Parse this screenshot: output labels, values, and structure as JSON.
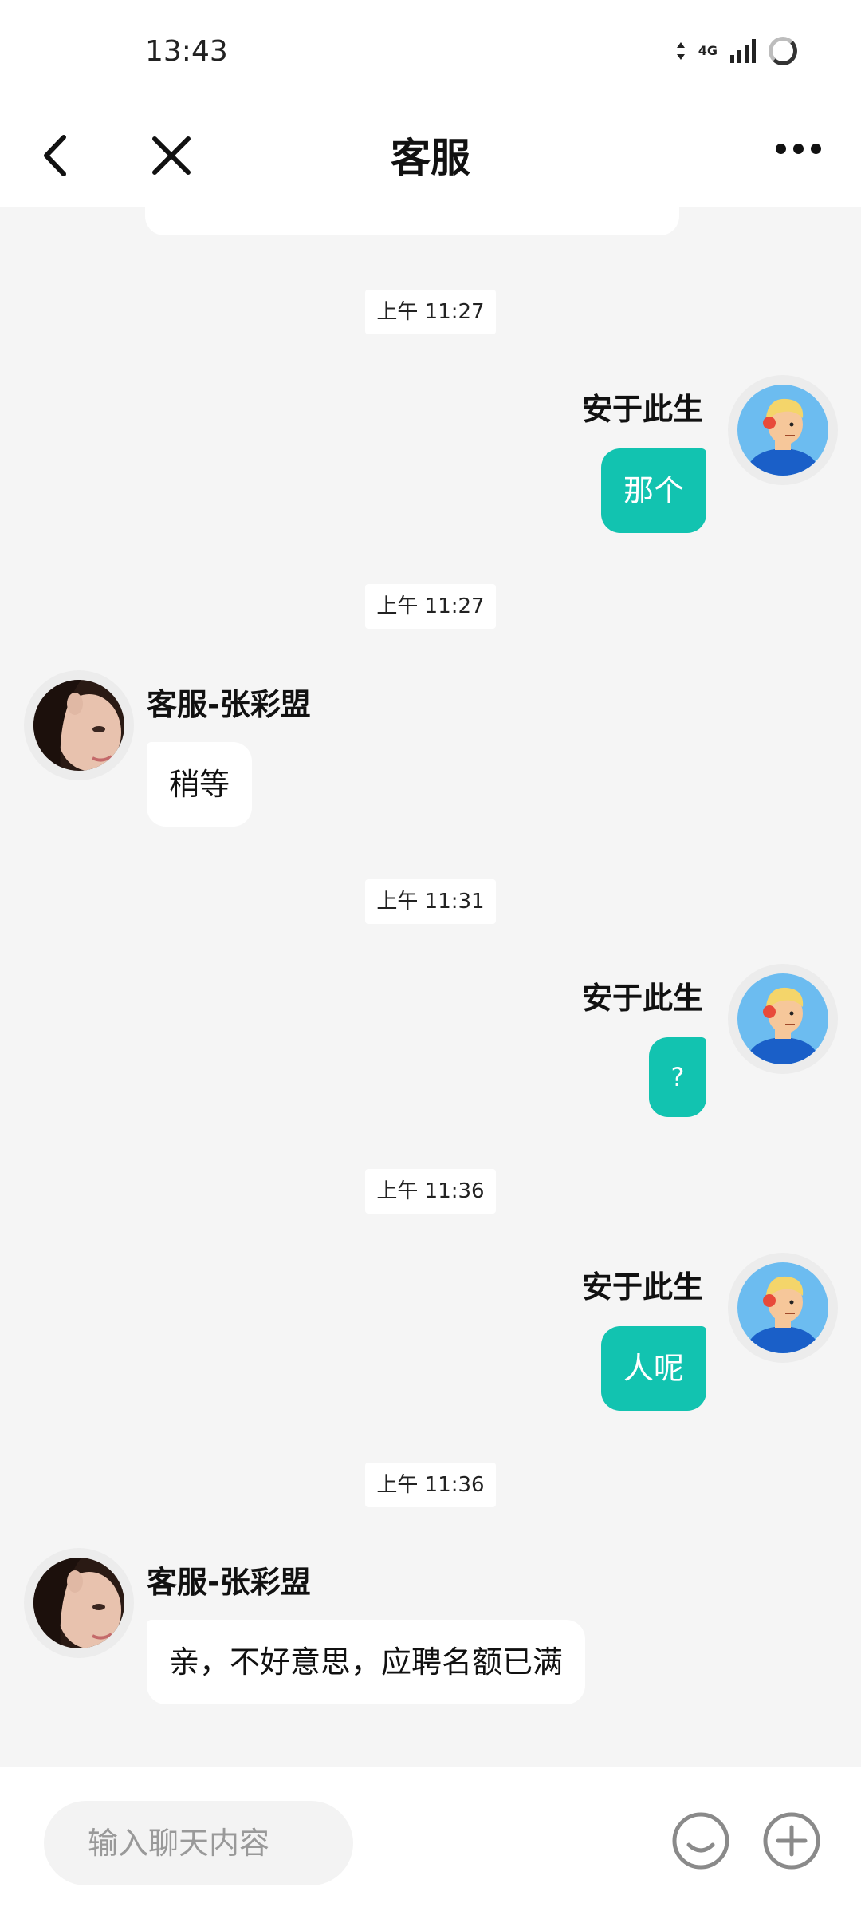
{
  "status_bar": {
    "time": "13:43",
    "network": "4G",
    "icons": [
      "data-arrows-icon",
      "signal-icon",
      "loading-ring-icon"
    ]
  },
  "nav": {
    "title": "客服",
    "back_icon": "chevron-left-icon",
    "close_icon": "close-icon",
    "more_icon": "more-dots-icon"
  },
  "messages": [
    {
      "timestamp": "上午 11:27",
      "side": "right",
      "sender": "安于此生",
      "text": "那个"
    },
    {
      "timestamp": "上午 11:27",
      "side": "left",
      "sender": "客服-张彩盟",
      "text": "稍等"
    },
    {
      "timestamp": "上午 11:31",
      "side": "right",
      "sender": "安于此生",
      "text": "?"
    },
    {
      "timestamp": "上午 11:36",
      "side": "right",
      "sender": "安于此生",
      "text": "人呢"
    },
    {
      "timestamp": "上午 11:36",
      "side": "left",
      "sender": "客服-张彩盟",
      "text": "亲，不好意思，应聘名额已满"
    }
  ],
  "input": {
    "placeholder": "输入聊天内容",
    "emoji_icon": "smile-icon",
    "plus_icon": "plus-circle-icon"
  },
  "colors": {
    "accent": "#12c3b0",
    "background": "#f5f5f5"
  }
}
